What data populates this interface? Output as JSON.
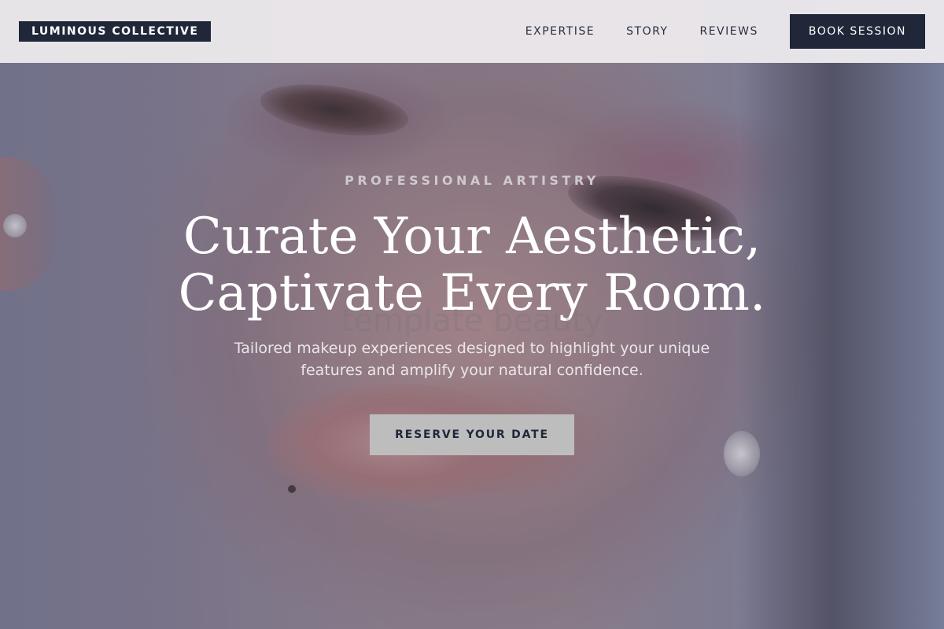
{
  "header": {
    "logo": "LUMINOUS COLLECTIVE",
    "nav": [
      "EXPERTISE",
      "STORY",
      "REVIEWS"
    ],
    "cta": "BOOK SESSION"
  },
  "hero": {
    "eyebrow": "PROFESSIONAL ARTISTRY",
    "headline_line1": "Curate Your Aesthetic,",
    "headline_line2": "Captivate Every Room.",
    "watermark": "template beauty",
    "subtext_line1": "Tailored makeup experiences designed to highlight your unique",
    "subtext_line2": "features and amplify your natural confidence.",
    "cta": "RESERVE YOUR DATE"
  },
  "colors": {
    "navy": "#1f2739",
    "header_bg": "#eeebee",
    "button_gray": "#bdbdbe",
    "eyebrow": "#cfc9d0"
  }
}
